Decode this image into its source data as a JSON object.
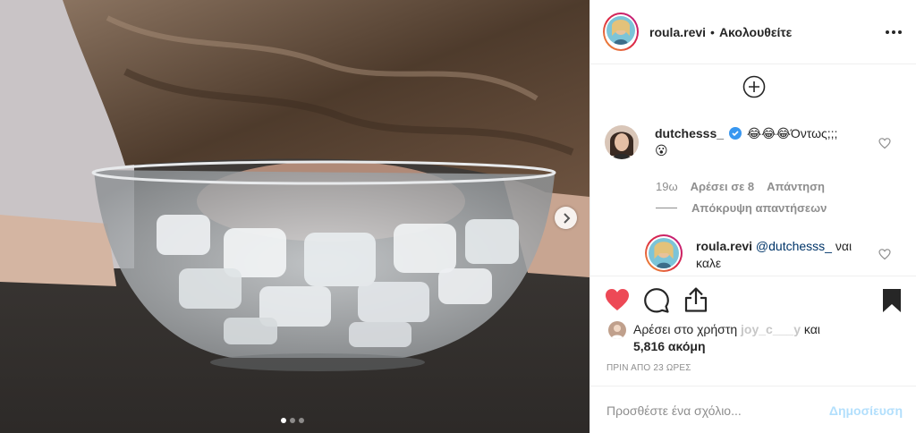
{
  "post": {
    "photo_alt": "",
    "carousel": {
      "count": 3,
      "active": 1
    }
  },
  "header": {
    "username": "roula.revi",
    "separator": "•",
    "follow_label": "Ακολουθείτε"
  },
  "comments": [
    {
      "username": "dutchesss_",
      "verified": true,
      "text": "😂😂😂Όντως;;;",
      "text2": "😮",
      "time": "19ω",
      "likes": "Αρέσει σε 8",
      "reply_label": "Απάντηση",
      "hide_replies_label": "Απόκρυψη απαντήσεων"
    },
    {
      "username": "roula.revi",
      "mention": "@dutchesss_",
      "text": "ναι",
      "text2": "καλε"
    }
  ],
  "likes": {
    "prefix": "Αρέσει στο χρήστη",
    "hidden_user": "joy_c___y",
    "and": "και",
    "count": "5,816 ακόμη"
  },
  "timestamp": "ΠΡΙΝ ΑΠΟ 23 ΩΡΕΣ",
  "comment_input": {
    "placeholder": "Προσθέστε ένα σχόλιο...",
    "post_label": "Δημοσίευση"
  },
  "colors": {
    "like_red": "#ed4956",
    "link_blue": "#0095f6",
    "post_disabled": "#b2dffc",
    "muted": "#8e8e8e"
  },
  "icons": [
    "more-icon",
    "plus-circle-icon",
    "heart-icon",
    "comment-icon",
    "share-icon",
    "bookmark-icon",
    "verified-icon",
    "chevron-right-icon"
  ]
}
